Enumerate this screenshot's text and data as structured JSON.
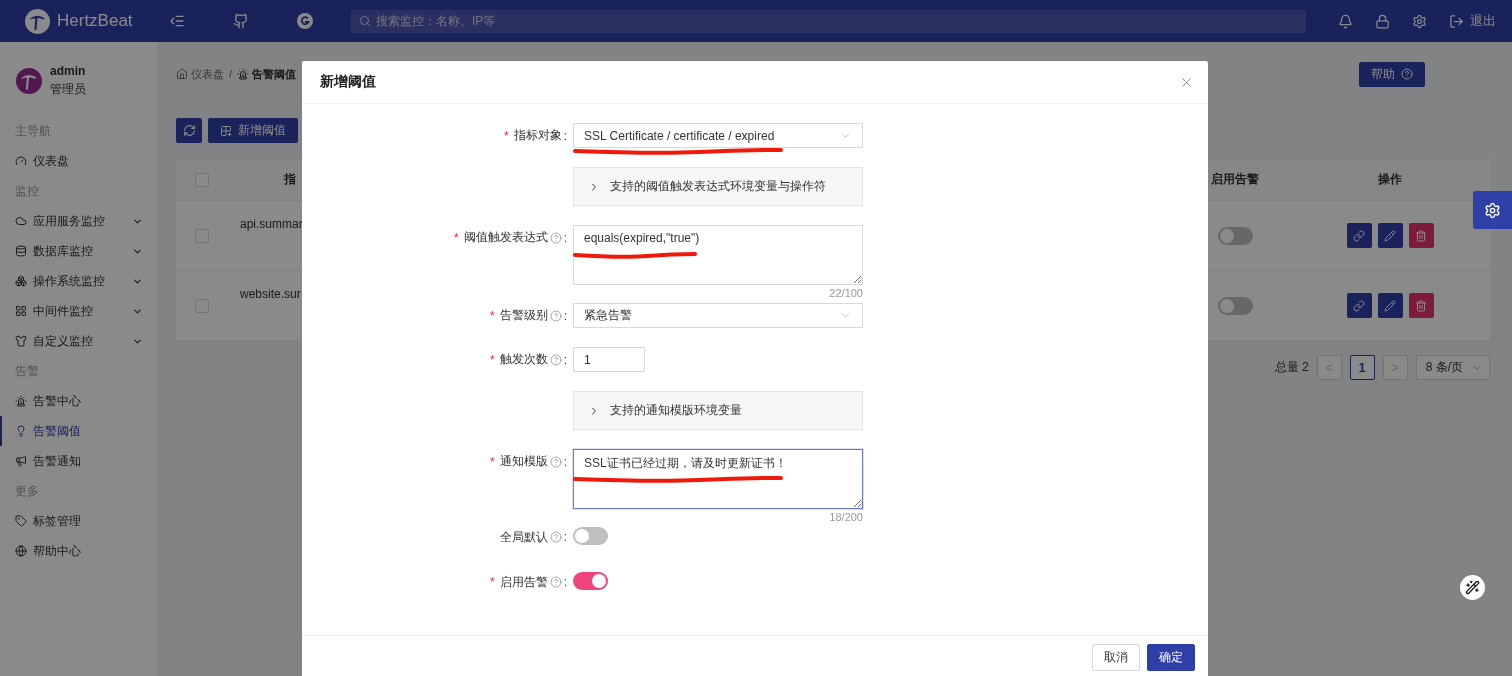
{
  "header": {
    "brand": "HertzBeat",
    "search_placeholder": "搜索监控：名称、IP等",
    "logout": "退出"
  },
  "user": {
    "name": "admin",
    "role": "管理员"
  },
  "sidebar": {
    "sections": [
      {
        "title": "主导航",
        "items": [
          {
            "label": "仪表盘",
            "expandable": false,
            "selected": false
          }
        ]
      },
      {
        "title": "监控",
        "items": [
          {
            "label": "应用服务监控",
            "expandable": true,
            "selected": false
          },
          {
            "label": "数据库监控",
            "expandable": true,
            "selected": false
          },
          {
            "label": "操作系统监控",
            "expandable": true,
            "selected": false
          },
          {
            "label": "中间件监控",
            "expandable": true,
            "selected": false
          },
          {
            "label": "自定义监控",
            "expandable": true,
            "selected": false
          }
        ]
      },
      {
        "title": "告警",
        "items": [
          {
            "label": "告警中心",
            "expandable": false,
            "selected": false
          },
          {
            "label": "告警阈值",
            "expandable": false,
            "selected": true
          },
          {
            "label": "告警通知",
            "expandable": false,
            "selected": false
          }
        ]
      },
      {
        "title": "更多",
        "items": [
          {
            "label": "标签管理",
            "expandable": false,
            "selected": false
          },
          {
            "label": "帮助中心",
            "expandable": false,
            "selected": false
          }
        ]
      }
    ]
  },
  "breadcrumb": [
    {
      "label": "仪表盘"
    },
    {
      "separator": "/",
      "label": "告警阈值"
    }
  ],
  "help_button": "帮助",
  "toolbar": {
    "add_button": "新增阈值"
  },
  "table": {
    "all_selected": false,
    "columns": [
      "指",
      "启用告警",
      "操作"
    ],
    "rows": [
      {
        "cell": "api.summar",
        "enabled": false,
        "selected": false
      },
      {
        "cell": "website.sur",
        "enabled": false,
        "selected": false
      }
    ]
  },
  "pagination": {
    "total": "总量 2",
    "prev": "<",
    "next": ">",
    "pages": [
      {
        "label": "1",
        "selected": true
      }
    ],
    "page_size": "8 条/页"
  },
  "dialog": {
    "title": "新增阈值",
    "required_mark": "*",
    "fields": [
      {
        "kind": "select",
        "label": "指标对象",
        "colon": ":",
        "required": true,
        "help": false,
        "value": "SSL Certificate / certificate / expired",
        "marked": true
      },
      {
        "kind": "collapse",
        "label": "支持的阈值触发表达式环境变量与操作符",
        "expanded": false
      },
      {
        "kind": "textarea",
        "label": "阈值触发表达式",
        "colon": ":",
        "required": true,
        "help": true,
        "value": "equals(expired,\"true\")",
        "count": "22/100",
        "focused": false,
        "marked": true
      },
      {
        "kind": "select",
        "label": "告警级别",
        "colon": ":",
        "required": true,
        "help": true,
        "value": "紧急告警",
        "marked": false
      },
      {
        "kind": "number",
        "label": "触发次数",
        "colon": ":",
        "required": true,
        "help": true,
        "value": "1"
      },
      {
        "kind": "collapse",
        "label": "支持的通知模版环境变量",
        "expanded": false
      },
      {
        "kind": "textarea",
        "label": "通知模版",
        "colon": ":",
        "required": true,
        "help": true,
        "value": "SSL证书已经过期，请及时更新证书！",
        "count": "18/200",
        "focused": true,
        "marked": true
      },
      {
        "kind": "switch",
        "label": "全局默认",
        "colon": ":",
        "required": false,
        "help": true,
        "on": false
      },
      {
        "kind": "switch",
        "label": "启用告警",
        "colon": ":",
        "required": true,
        "help": true,
        "on": true
      }
    ],
    "buttons": [
      {
        "label": "取消",
        "primary": false
      },
      {
        "label": "确定",
        "primary": true
      }
    ]
  }
}
